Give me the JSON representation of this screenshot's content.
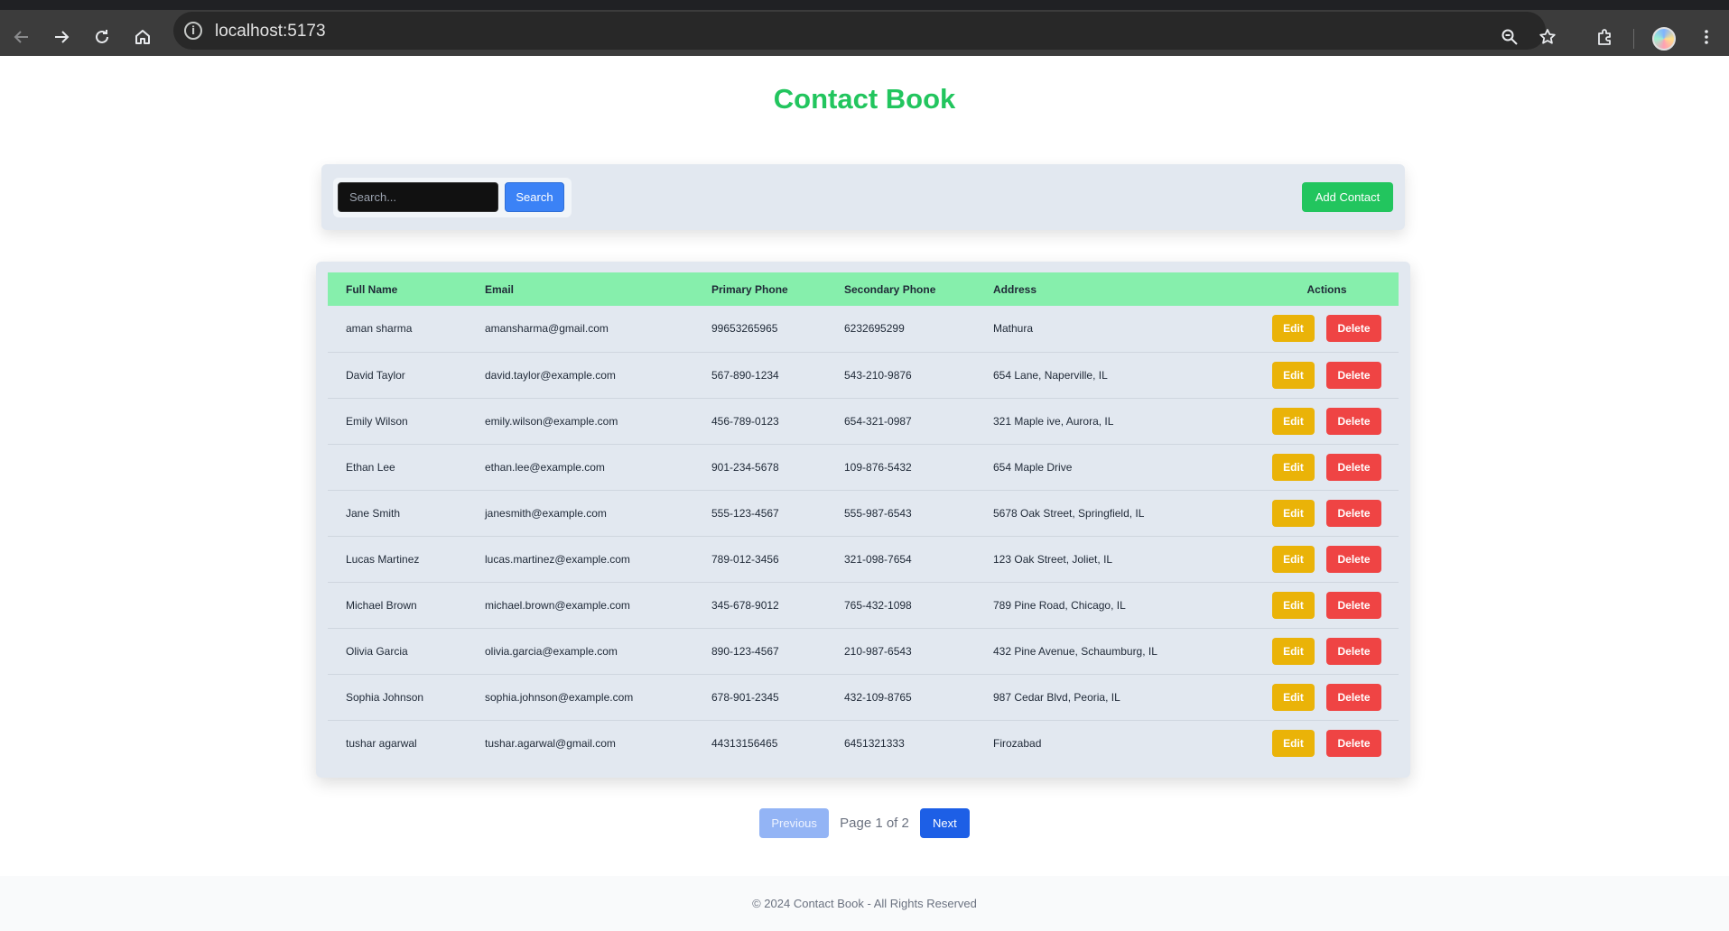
{
  "browser": {
    "url": "localhost:5173",
    "info_glyph": "i"
  },
  "app": {
    "title": "Contact Book"
  },
  "toolbar": {
    "search_placeholder": "Search...",
    "search_label": "Search",
    "add_label": "Add Contact"
  },
  "table": {
    "headers": [
      "Full Name",
      "Email",
      "Primary Phone",
      "Secondary Phone",
      "Address",
      "Actions"
    ],
    "edit_label": "Edit",
    "delete_label": "Delete",
    "rows": [
      {
        "name": "aman sharma",
        "email": "amansharma@gmail.com",
        "primary": "99653265965",
        "secondary": "6232695299",
        "address": "Mathura"
      },
      {
        "name": "David Taylor",
        "email": "david.taylor@example.com",
        "primary": "567-890-1234",
        "secondary": "543-210-9876",
        "address": "654 Lane, Naperville, IL"
      },
      {
        "name": "Emily Wilson",
        "email": "emily.wilson@example.com",
        "primary": "456-789-0123",
        "secondary": "654-321-0987",
        "address": "321 Maple ive, Aurora, IL"
      },
      {
        "name": "Ethan Lee",
        "email": "ethan.lee@example.com",
        "primary": "901-234-5678",
        "secondary": "109-876-5432",
        "address": "654 Maple Drive"
      },
      {
        "name": "Jane Smith",
        "email": "janesmith@example.com",
        "primary": "555-123-4567",
        "secondary": "555-987-6543",
        "address": "5678 Oak Street, Springfield, IL"
      },
      {
        "name": "Lucas Martinez",
        "email": "lucas.martinez@example.com",
        "primary": "789-012-3456",
        "secondary": "321-098-7654",
        "address": "123 Oak Street, Joliet, IL"
      },
      {
        "name": "Michael Brown",
        "email": "michael.brown@example.com",
        "primary": "345-678-9012",
        "secondary": "765-432-1098",
        "address": "789 Pine Road, Chicago, IL"
      },
      {
        "name": "Olivia Garcia",
        "email": "olivia.garcia@example.com",
        "primary": "890-123-4567",
        "secondary": "210-987-6543",
        "address": "432 Pine Avenue, Schaumburg, IL"
      },
      {
        "name": "Sophia Johnson",
        "email": "sophia.johnson@example.com",
        "primary": "678-901-2345",
        "secondary": "432-109-8765",
        "address": "987 Cedar Blvd, Peoria, IL"
      },
      {
        "name": "tushar agarwal",
        "email": "tushar.agarwal@gmail.com",
        "primary": "44313156465",
        "secondary": "6451321333",
        "address": "Firozabad"
      }
    ]
  },
  "pagination": {
    "previous_label": "Previous",
    "page_info": "Page 1 of 2",
    "next_label": "Next"
  },
  "footer": {
    "text": "© 2024 Contact Book - All Rights Reserved"
  },
  "colors": {
    "brand_green": "#22c55e",
    "header_green": "#86efac",
    "search_blue": "#3b82f6",
    "edit_yellow": "#eab308",
    "delete_red": "#ef4444",
    "next_blue": "#1d5fe6"
  },
  "icons": [
    "back-icon",
    "forward-icon",
    "reload-icon",
    "home-icon",
    "info-icon",
    "zoom-icon",
    "star-icon",
    "extensions-icon",
    "profile-avatar",
    "menu-icon"
  ]
}
